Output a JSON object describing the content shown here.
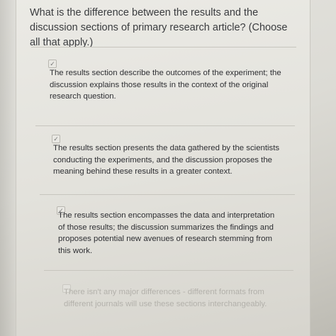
{
  "question": {
    "text": "What is the difference between the results and the discussion sections of primary research article? (Choose all that apply.)"
  },
  "options": [
    {
      "checked": true,
      "text": "The results section describe the outcomes of the experiment; the discussion explains those results in the context of the original research question.",
      "check_glyph": "✓"
    },
    {
      "checked": true,
      "text": "The results section presents the data gathered by the scientists conducting the experiments, and the discussion proposes the meaning behind these results in a greater context.",
      "check_glyph": "✓"
    },
    {
      "checked": true,
      "text": "The results section encompasses the data and interpretation of those results; the discussion summarizes the findings and proposes potential new avenues of research stemming from this work.",
      "check_glyph": "✓"
    },
    {
      "checked": false,
      "text": "There isn't any major differences - different formats from different journals will use these sections interchangeably.",
      "check_glyph": ""
    }
  ]
}
